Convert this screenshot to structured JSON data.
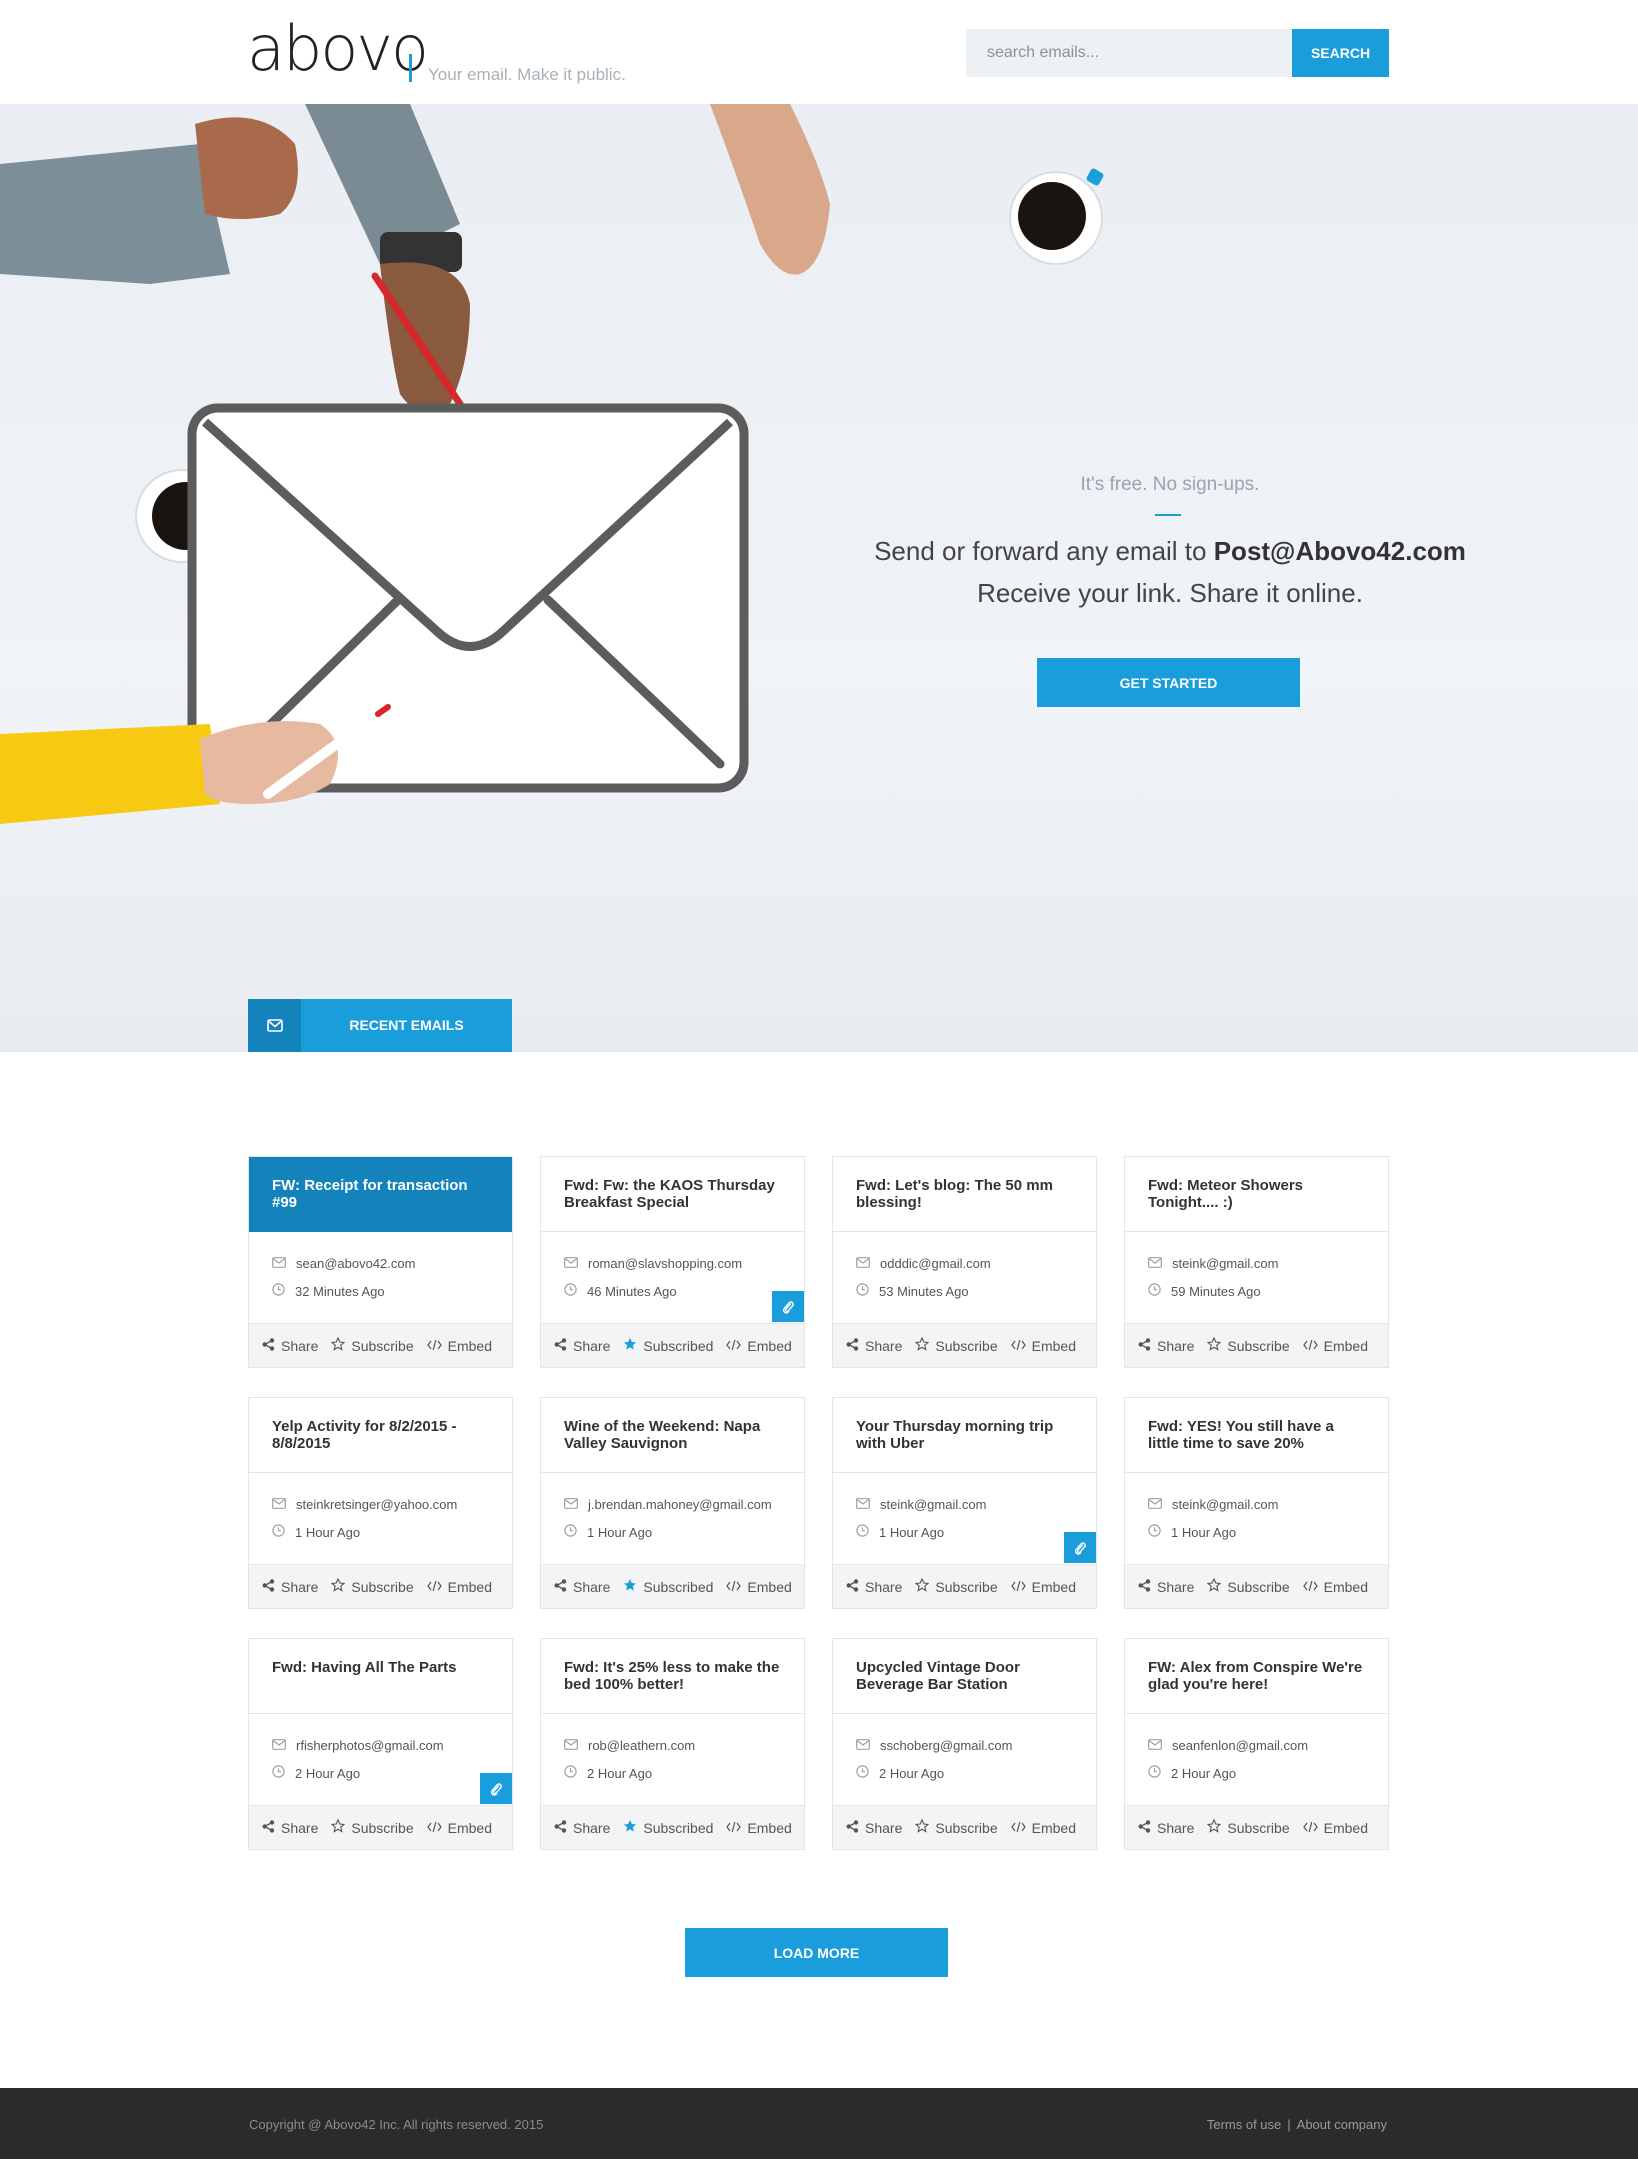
{
  "header": {
    "logo": "abovo",
    "tagline": "Your email. Make it public.",
    "search_placeholder": "search emails...",
    "search_button": "SEARCH"
  },
  "hero": {
    "free_text": "It's free. No sign-ups.",
    "send_prefix": "Send or forward any email to ",
    "send_address": "Post@Abovo42.com",
    "receive_text": "Receive your link. Share it online.",
    "cta": "GET STARTED"
  },
  "recent": {
    "tab_label": "RECENT EMAILS",
    "action_labels": {
      "share": "Share",
      "subscribe": "Subscribe",
      "subscribed": "Subscribed",
      "embed": "Embed"
    }
  },
  "emails": [
    {
      "title": "FW: Receipt for transaction #99",
      "sender": "sean@abovo42.com",
      "time": "32 Minutes Ago",
      "subscribed": false,
      "attachment": false,
      "active": true
    },
    {
      "title": "Fwd: Fw: the KAOS Thursday Breakfast Special",
      "sender": "roman@slavshopping.com",
      "time": "46 Minutes Ago",
      "subscribed": true,
      "attachment": true,
      "active": false
    },
    {
      "title": "Fwd: Let's blog: The 50 mm blessing!",
      "sender": "odddic@gmail.com",
      "time": "53 Minutes Ago",
      "subscribed": false,
      "attachment": false,
      "active": false
    },
    {
      "title": "Fwd: Meteor Showers Tonight.... :)",
      "sender": "steink@gmail.com",
      "time": "59 Minutes Ago",
      "subscribed": false,
      "attachment": false,
      "active": false
    },
    {
      "title": "Yelp Activity for 8/2/2015 - 8/8/2015",
      "sender": "steinkretsinger@yahoo.com",
      "time": "1 Hour Ago",
      "subscribed": false,
      "attachment": false,
      "active": false
    },
    {
      "title": "Wine of the Weekend: Napa Valley Sauvignon",
      "sender": "j.brendan.mahoney@gmail.com",
      "time": "1 Hour Ago",
      "subscribed": true,
      "attachment": false,
      "active": false
    },
    {
      "title": "Your Thursday morning trip with Uber",
      "sender": "steink@gmail.com",
      "time": "1 Hour Ago",
      "subscribed": false,
      "attachment": true,
      "active": false
    },
    {
      "title": "Fwd: YES! You still have a little time to save 20%",
      "sender": "steink@gmail.com",
      "time": "1 Hour Ago",
      "subscribed": false,
      "attachment": false,
      "active": false
    },
    {
      "title": "Fwd: Having All The Parts",
      "sender": "rfisherphotos@gmail.com",
      "time": "2 Hour Ago",
      "subscribed": false,
      "attachment": true,
      "active": false
    },
    {
      "title": "Fwd: It's 25% less to make the bed 100% better!",
      "sender": "rob@leathern.com",
      "time": "2 Hour Ago",
      "subscribed": true,
      "attachment": false,
      "active": false
    },
    {
      "title": "Upcycled Vintage Door Beverage Bar Station",
      "sender": "sschoberg@gmail.com",
      "time": "2 Hour Ago",
      "subscribed": false,
      "attachment": false,
      "active": false
    },
    {
      "title": "FW: Alex from Conspire We're glad you're here!",
      "sender": "seanfenlon@gmail.com",
      "time": "2 Hour Ago",
      "subscribed": false,
      "attachment": false,
      "active": false
    }
  ],
  "load_more": "LOAD MORE",
  "footer": {
    "copyright": "Copyright @ Abovo42 Inc. All rights reserved. 2015",
    "terms": "Terms of use",
    "divider": "|",
    "about": "About company"
  },
  "colors": {
    "accent": "#1a9ddb",
    "accent_dark": "#1583bb",
    "footer": "#2b2b2b"
  }
}
